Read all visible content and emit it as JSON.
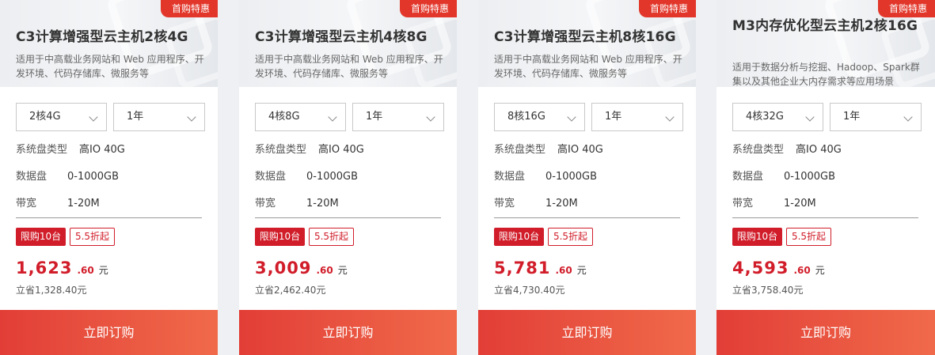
{
  "cards": [
    {
      "badge": "首购特惠",
      "title": "C3计算增强型云主机2核4G",
      "desc": "适用于中高载业务网站和 Web 应用程序、开发环境、代码存储库、微服务等",
      "spec_select": "2核4G",
      "duration_select": "1年",
      "disk_type_label": "系统盘类型",
      "disk_type_value": "高IO 40G",
      "data_disk_label": "数据盘",
      "data_disk_value": "0-1000GB",
      "bandwidth_label": "带宽",
      "bandwidth_value": "1-20M",
      "tag_limit": "限购10台",
      "tag_discount": "5.5折起",
      "price_int": "1,623",
      "price_dec": ".60",
      "price_unit": "元",
      "saving": "立省1,328.40元",
      "buy_label": "立即订购"
    },
    {
      "badge": "首购特惠",
      "title": "C3计算增强型云主机4核8G",
      "desc": "适用于中高载业务网站和 Web 应用程序、开发环境、代码存储库、微服务等",
      "spec_select": "4核8G",
      "duration_select": "1年",
      "disk_type_label": "系统盘类型",
      "disk_type_value": "高IO 40G",
      "data_disk_label": "数据盘",
      "data_disk_value": "0-1000GB",
      "bandwidth_label": "带宽",
      "bandwidth_value": "1-20M",
      "tag_limit": "限购10台",
      "tag_discount": "5.5折起",
      "price_int": "3,009",
      "price_dec": ".60",
      "price_unit": "元",
      "saving": "立省2,462.40元",
      "buy_label": "立即订购"
    },
    {
      "badge": "首购特惠",
      "title": "C3计算增强型云主机8核16G",
      "desc": "适用于中高载业务网站和 Web 应用程序、开发环境、代码存储库、微服务等",
      "spec_select": "8核16G",
      "duration_select": "1年",
      "disk_type_label": "系统盘类型",
      "disk_type_value": "高IO 40G",
      "data_disk_label": "数据盘",
      "data_disk_value": "0-1000GB",
      "bandwidth_label": "带宽",
      "bandwidth_value": "1-20M",
      "tag_limit": "限购10台",
      "tag_discount": "5.5折起",
      "price_int": "5,781",
      "price_dec": ".60",
      "price_unit": "元",
      "saving": "立省4,730.40元",
      "buy_label": "立即订购"
    },
    {
      "badge": "首购特惠",
      "title": "M3内存优化型云主机2核16G",
      "desc": "适用于数据分析与挖掘、Hadoop、Spark群集以及其他企业大内存需求等应用场景",
      "spec_select": "4核32G",
      "duration_select": "1年",
      "disk_type_label": "系统盘类型",
      "disk_type_value": "高IO 40G",
      "data_disk_label": "数据盘",
      "data_disk_value": "0-1000GB",
      "bandwidth_label": "带宽",
      "bandwidth_value": "1-20M",
      "tag_limit": "限购10台",
      "tag_discount": "5.5折起",
      "price_int": "4,593",
      "price_dec": ".60",
      "price_unit": "元",
      "saving": "立省3,758.40元",
      "buy_label": "立即订购"
    }
  ]
}
